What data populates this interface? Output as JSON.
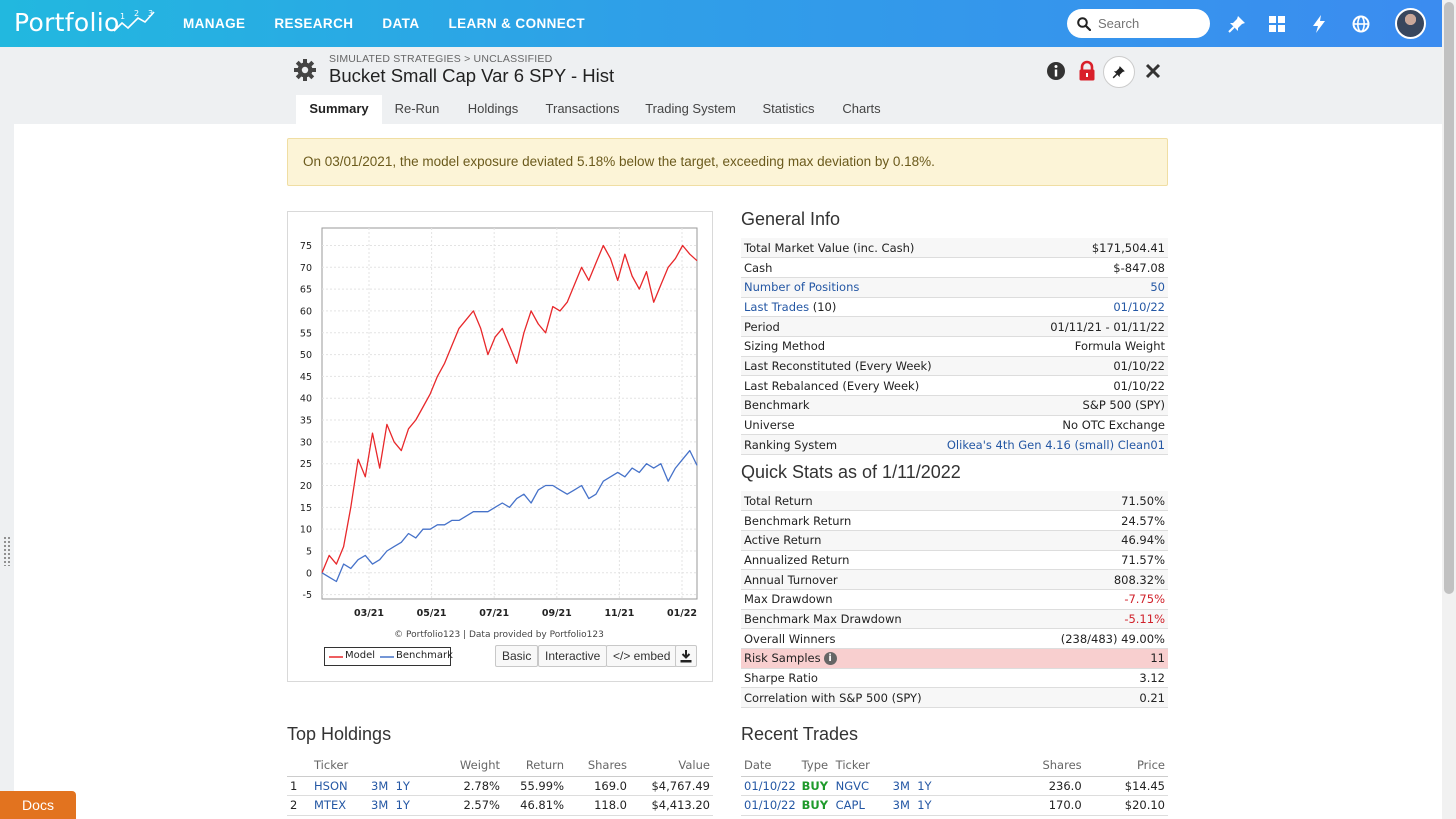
{
  "app": {
    "logo": "Portfolio",
    "logo_superscript": "123",
    "nav": [
      "MANAGE",
      "RESEARCH",
      "DATA",
      "LEARN & CONNECT"
    ],
    "search_placeholder": "Search",
    "icons": [
      "pin-icon",
      "dashboard-grid-icon",
      "bolt-icon",
      "globe-icon"
    ]
  },
  "header": {
    "breadcrumb": "SIMULATED STRATEGIES > UNCLASSIFIED",
    "title": "Bucket Small Cap Var 6 SPY - Hist",
    "icons": [
      "gear-icon",
      "info-icon",
      "lock-icon",
      "pin-icon",
      "close-icon"
    ]
  },
  "tabs": [
    "Summary",
    "Re-Run",
    "Holdings",
    "Transactions",
    "Trading System",
    "Statistics",
    "Charts"
  ],
  "active_tab": "Summary",
  "alert": "On 03/01/2021, the model exposure deviated 5.18% below the target, exceeding max deviation by 0.18%.",
  "chart_controls": {
    "copyright": "© Portfolio123 | Data provided by Portfolio123",
    "buttons": [
      "Basic",
      "Interactive",
      "</> embed"
    ],
    "download_icon": "download-icon"
  },
  "chart_data": {
    "type": "line",
    "x_labels": [
      "03/21",
      "05/21",
      "07/21",
      "09/21",
      "11/21",
      "01/22"
    ],
    "y_ticks": [
      -5,
      0,
      5,
      10,
      15,
      20,
      25,
      30,
      35,
      40,
      45,
      50,
      55,
      60,
      65,
      70,
      75
    ],
    "ylim": [
      -6,
      79
    ],
    "xlim": [
      0,
      52
    ],
    "grid": true,
    "legend": "bottom-left",
    "series": [
      {
        "name": "Model",
        "color": "#e8282b",
        "points": [
          [
            0,
            0
          ],
          [
            1,
            4
          ],
          [
            2,
            2
          ],
          [
            3,
            6
          ],
          [
            4,
            15
          ],
          [
            5,
            26
          ],
          [
            6,
            22
          ],
          [
            7,
            32
          ],
          [
            8,
            24
          ],
          [
            9,
            34
          ],
          [
            10,
            30
          ],
          [
            11,
            28
          ],
          [
            12,
            33
          ],
          [
            13,
            35
          ],
          [
            14,
            38
          ],
          [
            15,
            41
          ],
          [
            16,
            45
          ],
          [
            17,
            48
          ],
          [
            18,
            52
          ],
          [
            19,
            56
          ],
          [
            20,
            58
          ],
          [
            21,
            60
          ],
          [
            22,
            56
          ],
          [
            23,
            50
          ],
          [
            24,
            54
          ],
          [
            25,
            56
          ],
          [
            26,
            52
          ],
          [
            27,
            48
          ],
          [
            28,
            55
          ],
          [
            29,
            60
          ],
          [
            30,
            57
          ],
          [
            31,
            55
          ],
          [
            32,
            61
          ],
          [
            33,
            60
          ],
          [
            34,
            62
          ],
          [
            35,
            66
          ],
          [
            36,
            70
          ],
          [
            37,
            67
          ],
          [
            38,
            71
          ],
          [
            39,
            75
          ],
          [
            40,
            72
          ],
          [
            41,
            67
          ],
          [
            42,
            73
          ],
          [
            43,
            68
          ],
          [
            44,
            65
          ],
          [
            45,
            69
          ],
          [
            46,
            62
          ],
          [
            47,
            66
          ],
          [
            48,
            70
          ],
          [
            49,
            72
          ],
          [
            50,
            75
          ],
          [
            51,
            73
          ],
          [
            52,
            71.5
          ]
        ]
      },
      {
        "name": "Benchmark",
        "color": "#4672c9",
        "points": [
          [
            0,
            0
          ],
          [
            1,
            -1
          ],
          [
            2,
            -2
          ],
          [
            3,
            2
          ],
          [
            4,
            1
          ],
          [
            5,
            3
          ],
          [
            6,
            4
          ],
          [
            7,
            2
          ],
          [
            8,
            3
          ],
          [
            9,
            5
          ],
          [
            10,
            6
          ],
          [
            11,
            7
          ],
          [
            12,
            9
          ],
          [
            13,
            8
          ],
          [
            14,
            10
          ],
          [
            15,
            10
          ],
          [
            16,
            11
          ],
          [
            17,
            11
          ],
          [
            18,
            12
          ],
          [
            19,
            12
          ],
          [
            20,
            13
          ],
          [
            21,
            14
          ],
          [
            22,
            14
          ],
          [
            23,
            14
          ],
          [
            24,
            15
          ],
          [
            25,
            16
          ],
          [
            26,
            15
          ],
          [
            27,
            17
          ],
          [
            28,
            18
          ],
          [
            29,
            16
          ],
          [
            30,
            19
          ],
          [
            31,
            20
          ],
          [
            32,
            20
          ],
          [
            33,
            19
          ],
          [
            34,
            18
          ],
          [
            35,
            19
          ],
          [
            36,
            20
          ],
          [
            37,
            17
          ],
          [
            38,
            18
          ],
          [
            39,
            21
          ],
          [
            40,
            22
          ],
          [
            41,
            23
          ],
          [
            42,
            22
          ],
          [
            43,
            24
          ],
          [
            44,
            23
          ],
          [
            45,
            25
          ],
          [
            46,
            24
          ],
          [
            47,
            25
          ],
          [
            48,
            21
          ],
          [
            49,
            24
          ],
          [
            50,
            26
          ],
          [
            51,
            28
          ],
          [
            52,
            24.6
          ]
        ]
      }
    ]
  },
  "general_info": {
    "title": "General Info",
    "rows": [
      {
        "label": "Total Market Value (inc. Cash)",
        "value": "$171,504.41"
      },
      {
        "label": "Cash",
        "value": "$-847.08"
      },
      {
        "label": "Number of Positions",
        "value": "50"
      },
      {
        "label": "Last Trades",
        "label_suffix": "(10)",
        "value": "01/10/22"
      },
      {
        "label": "Period",
        "value": "01/11/21 - 01/11/22"
      },
      {
        "label": "Sizing Method",
        "value": "Formula Weight"
      },
      {
        "label": "Last Reconstituted (Every Week)",
        "value": "01/10/22"
      },
      {
        "label": "Last Rebalanced (Every Week)",
        "value": "01/10/22"
      },
      {
        "label": "Benchmark",
        "value": "S&P 500 (SPY)"
      },
      {
        "label": "Universe",
        "value": "No OTC Exchange"
      },
      {
        "label": "Ranking System",
        "value": "Olikea's 4th Gen 4.16 (small) Clean01"
      }
    ]
  },
  "quick_stats": {
    "title": "Quick Stats as of 1/11/2022",
    "rows": [
      {
        "label": "Total Return",
        "value": "71.50%"
      },
      {
        "label": "Benchmark Return",
        "value": "24.57%"
      },
      {
        "label": "Active Return",
        "value": "46.94%"
      },
      {
        "label": "Annualized Return",
        "value": "71.57%"
      },
      {
        "label": "Annual Turnover",
        "value": "808.32%"
      },
      {
        "label": "Max Drawdown",
        "value": "-7.75%"
      },
      {
        "label": "Benchmark Max Drawdown",
        "value": "-5.11%"
      },
      {
        "label": "Overall Winners",
        "value": "(238/483) 49.00%"
      },
      {
        "label": "Risk Samples",
        "value": "11"
      },
      {
        "label": "Sharpe Ratio",
        "value": "3.12"
      },
      {
        "label": "Correlation with S&P 500 (SPY)",
        "value": "0.21"
      }
    ]
  },
  "top_holdings": {
    "title": "Top Holdings",
    "columns": [
      "Ticker",
      "Weight",
      "Return",
      "Shares",
      "Value"
    ],
    "rows": [
      {
        "n": "1",
        "ticker": "HSON",
        "p1": "3M",
        "p2": "1Y",
        "weight": "2.78%",
        "return": "55.99%",
        "shares": "169.0",
        "value": "$4,767.49"
      },
      {
        "n": "2",
        "ticker": "MTEX",
        "p1": "3M",
        "p2": "1Y",
        "weight": "2.57%",
        "return": "46.81%",
        "shares": "118.0",
        "value": "$4,413.20"
      }
    ]
  },
  "recent_trades": {
    "title": "Recent Trades",
    "columns": [
      "Date",
      "Type",
      "Ticker",
      "Shares",
      "Price"
    ],
    "rows": [
      {
        "date": "01/10/22",
        "type": "BUY",
        "ticker": "NGVC",
        "p1": "3M",
        "p2": "1Y",
        "shares": "236.0",
        "price": "$14.45"
      },
      {
        "date": "01/10/22",
        "type": "BUY",
        "ticker": "CAPL",
        "p1": "3M",
        "p2": "1Y",
        "shares": "170.0",
        "price": "$20.10"
      }
    ]
  },
  "docs_button": "Docs"
}
